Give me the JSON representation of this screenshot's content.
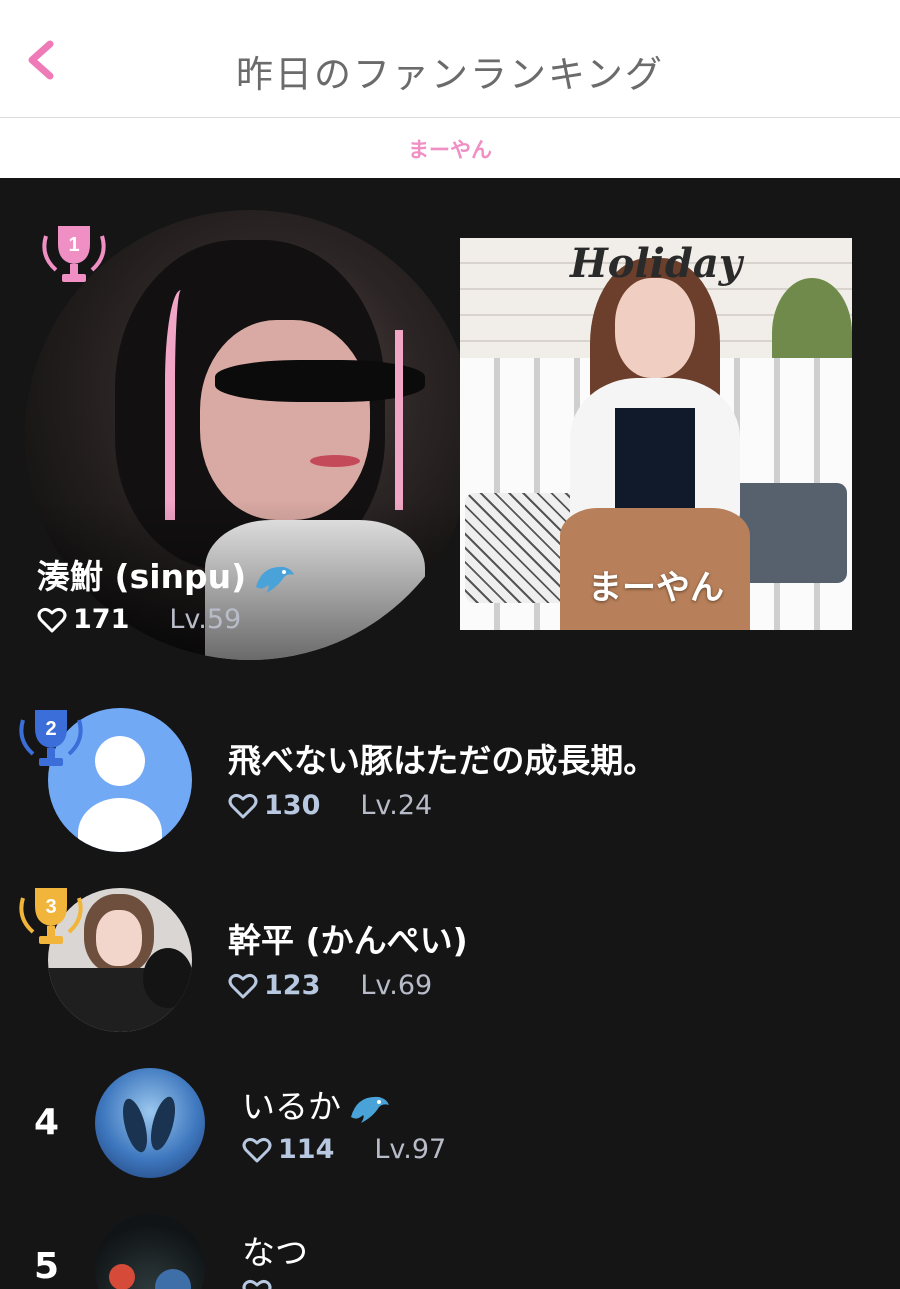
{
  "header": {
    "title": "昨日のファンランキング",
    "back_icon": "chevron-left-icon",
    "accent": "#ef7ab8"
  },
  "subtitle": "まーやん",
  "streamer": {
    "name": "まーやん",
    "photo_sign": "Holiday"
  },
  "ranking": [
    {
      "rank": "1",
      "name": "湊鮒 (sinpu)",
      "emoji_icon": "dolphin-icon",
      "hearts": "171",
      "level": "Lv.59",
      "trophy_color": "#ef8fc4"
    },
    {
      "rank": "2",
      "name": "飛べない豚はただの成長期。",
      "hearts": "130",
      "level": "Lv.24",
      "trophy_color": "#3b6ed8"
    },
    {
      "rank": "3",
      "name": "幹平 (かんぺい)",
      "hearts": "123",
      "level": "Lv.69",
      "trophy_color": "#f0b53a"
    },
    {
      "rank": "4",
      "name": "いるか",
      "emoji_icon": "dolphin-icon",
      "hearts": "114",
      "level": "Lv.97"
    },
    {
      "rank": "5",
      "name": "なつ",
      "hearts": "",
      "level": ""
    }
  ]
}
